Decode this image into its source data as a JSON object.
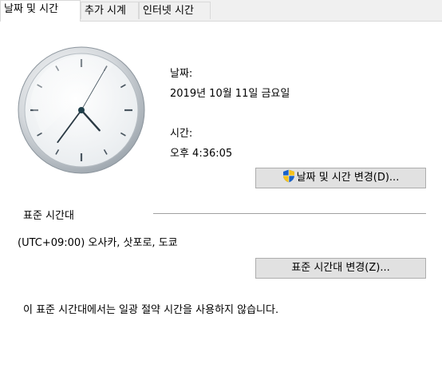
{
  "tabs": [
    {
      "label": "날짜 및 시간"
    },
    {
      "label": "추가 시계"
    },
    {
      "label": "인터넷 시간"
    }
  ],
  "clock": {
    "hour": 4,
    "minute": 36,
    "second": 5
  },
  "date": {
    "label": "날짜:",
    "value": "2019년 10월 11일 금요일"
  },
  "time": {
    "label": "시간:",
    "value": "오후 4:36:05"
  },
  "change_datetime_button": "날짜 및 시간 변경(D)...",
  "timezone": {
    "section_label": "표준 시간대",
    "value": "(UTC+09:00) 오사카, 삿포로, 도쿄",
    "change_button": "표준 시간대 변경(Z)...",
    "dst_note": "이 표준 시간대에서는 일광 절약 시간을 사용하지 않습니다."
  },
  "icons": {
    "shield": "uac-shield-icon"
  }
}
